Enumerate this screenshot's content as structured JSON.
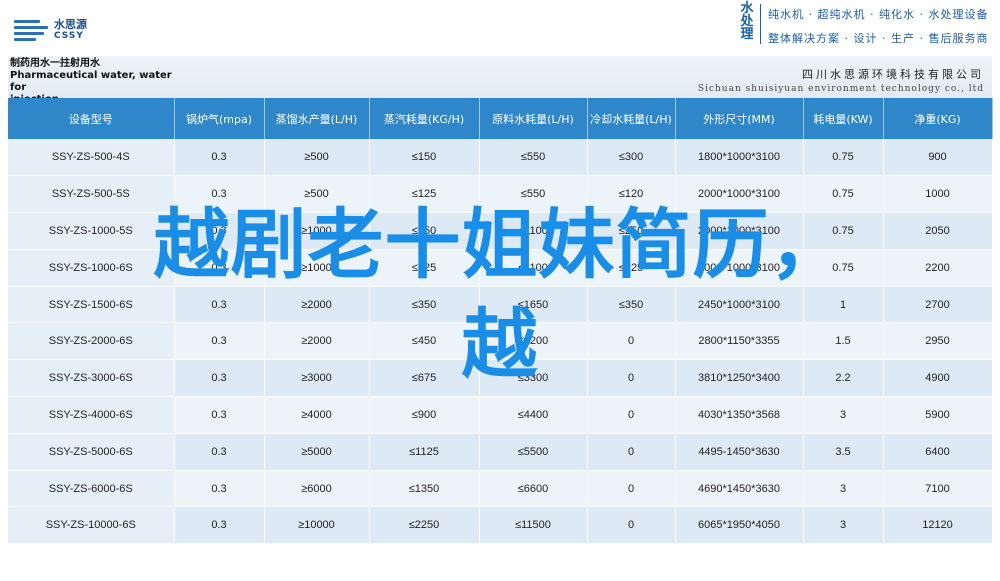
{
  "logo": {
    "cn": "水思源",
    "en": "CSSY"
  },
  "brand": {
    "vertical": [
      "水",
      "处",
      "理"
    ],
    "line1": "纯水机 · 超纯水机 · 纯化水 · 水处理设备",
    "line2": "整体解决方案 · 设计 · 生产 · 售后服务商"
  },
  "band": {
    "title_lines": [
      "制药用水一拄射用水",
      "Pharmaceutical water, water for",
      "injection"
    ],
    "company_cn": "四川水思源环境科技有限公司",
    "company_en": "Sichuan shuisiyuan environment technology co., ltd"
  },
  "table": {
    "headers": [
      "设备型号",
      "锅炉气(mpa)",
      "蒸馏水产量(L/H)",
      "蒸汽耗量(KG/H)",
      "原料水耗量(L/H)",
      "冷却水耗量(L/H)",
      "外形尺寸(MM)",
      "耗电量(KW)",
      "净重(KG)"
    ],
    "rows": [
      [
        "SSY-ZS-500-4S",
        "0.3",
        "≥500",
        "≤150",
        "≤550",
        "≤300",
        "1800*1000*3100",
        "0.75",
        "900"
      ],
      [
        "SSY-ZS-500-5S",
        "0.3",
        "≥500",
        "≤125",
        "≤550",
        "≤120",
        "2000*1000*3100",
        "0.75",
        "1000"
      ],
      [
        "SSY-ZS-1000-5S",
        "0.3",
        "≥1000",
        "≤250",
        "≤1100",
        "≤250",
        "2000*1000*3100",
        "0.75",
        "2050"
      ],
      [
        "SSY-ZS-1000-6S",
        "0.3",
        "≥1000",
        "≤225",
        "≤1100",
        "≤225",
        "2000*1000*3100",
        "0.75",
        "2200"
      ],
      [
        "SSY-ZS-1500-6S",
        "0.3",
        "≥2000",
        "≤350",
        "≤1650",
        "≤350",
        "2450*1000*3100",
        "1",
        "2700"
      ],
      [
        "SSY-ZS-2000-6S",
        "0.3",
        "≥2000",
        "≤450",
        "≤2200",
        "0",
        "2800*1150*3355",
        "1.5",
        "2950"
      ],
      [
        "SSY-ZS-3000-6S",
        "0.3",
        "≥3000",
        "≤675",
        "≤3300",
        "0",
        "3810*1250*3400",
        "2.2",
        "4900"
      ],
      [
        "SSY-ZS-4000-6S",
        "0.3",
        "≥4000",
        "≤900",
        "≤4400",
        "0",
        "4030*1350*3568",
        "3",
        "5900"
      ],
      [
        "SSY-ZS-5000-6S",
        "0.3",
        "≥5000",
        "≤1125",
        "≤5500",
        "0",
        "4495-1450*3630",
        "3.5",
        "6400"
      ],
      [
        "SSY-ZS-6000-6S",
        "0.3",
        "≥6000",
        "≤1350",
        "≤6600",
        "0",
        "4690*1450*3630",
        "3",
        "7100"
      ],
      [
        "SSY-ZS-10000-6S",
        "0.3",
        "≥10000",
        "≤2250",
        "≤11500",
        "0",
        "6065*1950*4050",
        "3",
        "12120"
      ]
    ]
  },
  "overlay": {
    "line1": "越剧老十姐妹简历，",
    "line2": "越"
  }
}
